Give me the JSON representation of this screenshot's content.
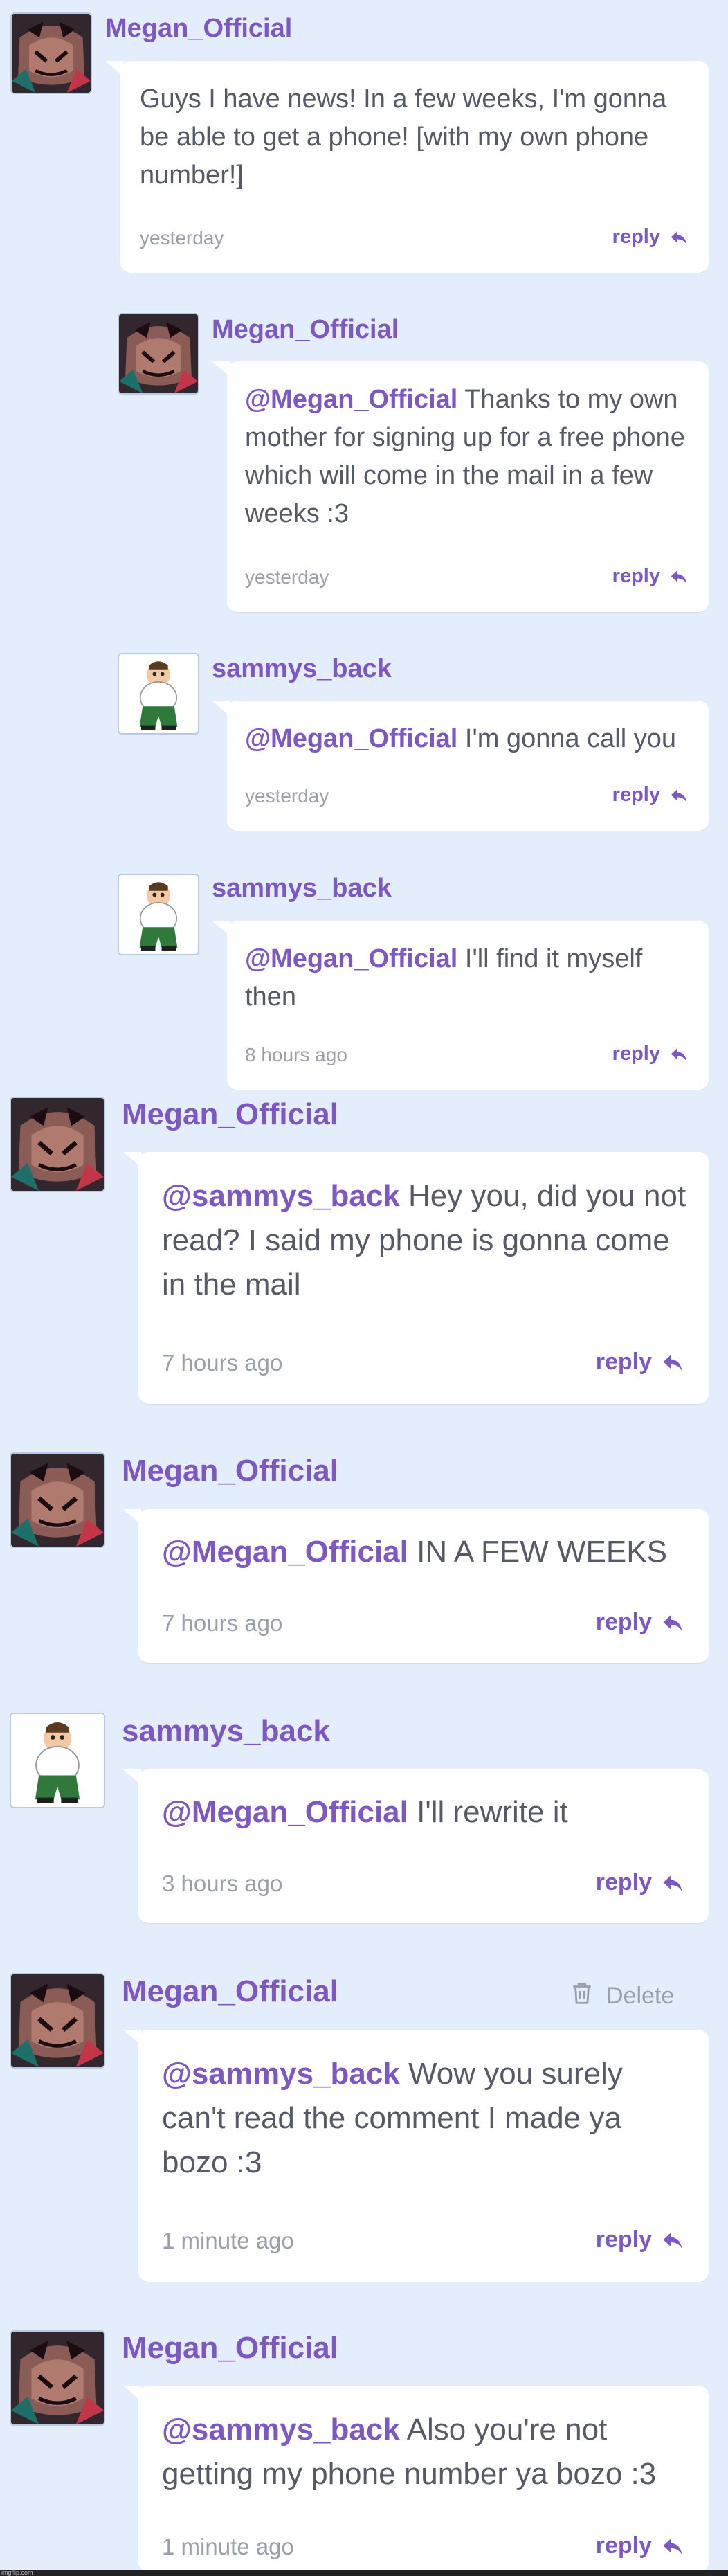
{
  "comments": [
    {
      "username": "Megan_Official",
      "avatar": "megan-avatar",
      "mention": "",
      "text": "Guys I have news! In a few weeks, I'm gonna be able to get a phone! [with my own phone number!]",
      "time": "yesterday",
      "reply_label": "reply"
    },
    {
      "username": "Megan_Official",
      "avatar": "megan-avatar",
      "mention": "@Megan_Official",
      "text": "Thanks to my own mother for signing up for a free phone which will come in the mail in a few weeks :3",
      "time": "yesterday",
      "reply_label": "reply"
    },
    {
      "username": "sammys_back",
      "avatar": "peter-avatar",
      "mention": "@Megan_Official",
      "text": "I'm gonna call you",
      "time": "yesterday",
      "reply_label": "reply"
    },
    {
      "username": "sammys_back",
      "avatar": "peter-avatar",
      "mention": "@Megan_Official",
      "text": "I'll find it myself then",
      "time": "8 hours ago",
      "reply_label": "reply"
    },
    {
      "username": "Megan_Official",
      "avatar": "megan-avatar",
      "mention": "@sammys_back",
      "text": "Hey you, did you not read? I said my phone is gonna come in the mail",
      "time": "7 hours ago",
      "reply_label": "reply"
    },
    {
      "username": "Megan_Official",
      "avatar": "megan-avatar",
      "mention": "@Megan_Official",
      "text": "IN A FEW WEEKS",
      "time": "7 hours ago",
      "reply_label": "reply"
    },
    {
      "username": "sammys_back",
      "avatar": "peter-avatar",
      "mention": "@Megan_Official",
      "text": "I'll rewrite it",
      "time": "3 hours ago",
      "reply_label": "reply"
    },
    {
      "username": "Megan_Official",
      "avatar": "megan-avatar",
      "mention": "@sammys_back",
      "text": "Wow you surely can't read the comment I made ya bozo :3",
      "time": "1 minute ago",
      "reply_label": "reply",
      "delete_label": "Delete"
    },
    {
      "username": "Megan_Official",
      "avatar": "megan-avatar",
      "mention": "@sammys_back",
      "text": "Also you're not getting my phone number ya bozo :3",
      "time": "1 minute ago",
      "reply_label": "reply"
    }
  ],
  "watermark": "imgflip.com",
  "colors": {
    "background": "#e4edfb",
    "accent": "#7e58c2",
    "text": "#555a66",
    "muted": "#9aa0ab"
  }
}
